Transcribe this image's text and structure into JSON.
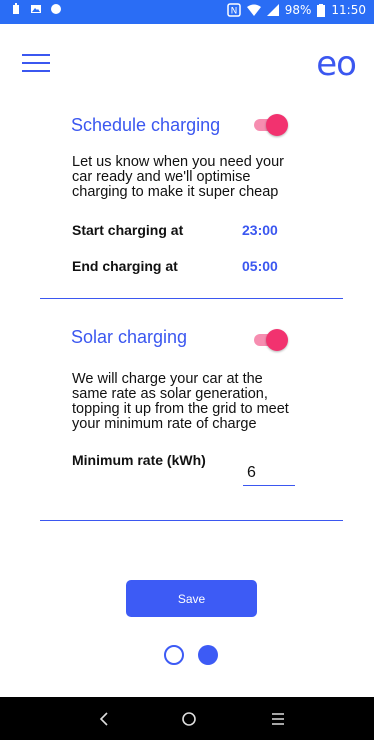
{
  "status_bar": {
    "battery": "98%",
    "time": "11:50",
    "left_icons": [
      "charging-icon",
      "image-icon",
      "circle-icon"
    ],
    "right_icons": [
      "nfc-icon",
      "wifi-icon",
      "signal-icon",
      "battery-icon"
    ]
  },
  "header": {
    "logo": "eo",
    "menu_icon": "hamburger-menu-icon"
  },
  "schedule": {
    "title": "Schedule charging",
    "enabled": true,
    "description_lines": [
      "Let us know when you need your",
      "car ready and we'll optimise",
      "charging to make it super cheap"
    ],
    "start_label": "Start charging at",
    "start_time": "23:00",
    "end_label": "End charging at",
    "end_time": "05:00"
  },
  "solar": {
    "title": "Solar charging",
    "enabled": true,
    "description_lines": [
      "We will charge your car at the",
      "same rate as solar generation,",
      "topping it up from the grid to meet",
      "your minimum rate of charge"
    ],
    "min_rate_label": "Minimum rate (kWh)",
    "min_rate_value": "6"
  },
  "actions": {
    "save_label": "Save"
  },
  "pager": {
    "count": 2,
    "active_index": 1
  },
  "nav_bar": {
    "back_icon": "back-icon",
    "home_icon": "home-icon",
    "menu_icon": "menu-icon"
  },
  "colors": {
    "status_bar": "#2a6df5",
    "accent": "#3b57f0",
    "toggle_on": "#f2326f",
    "nav_bar": "#000000"
  }
}
